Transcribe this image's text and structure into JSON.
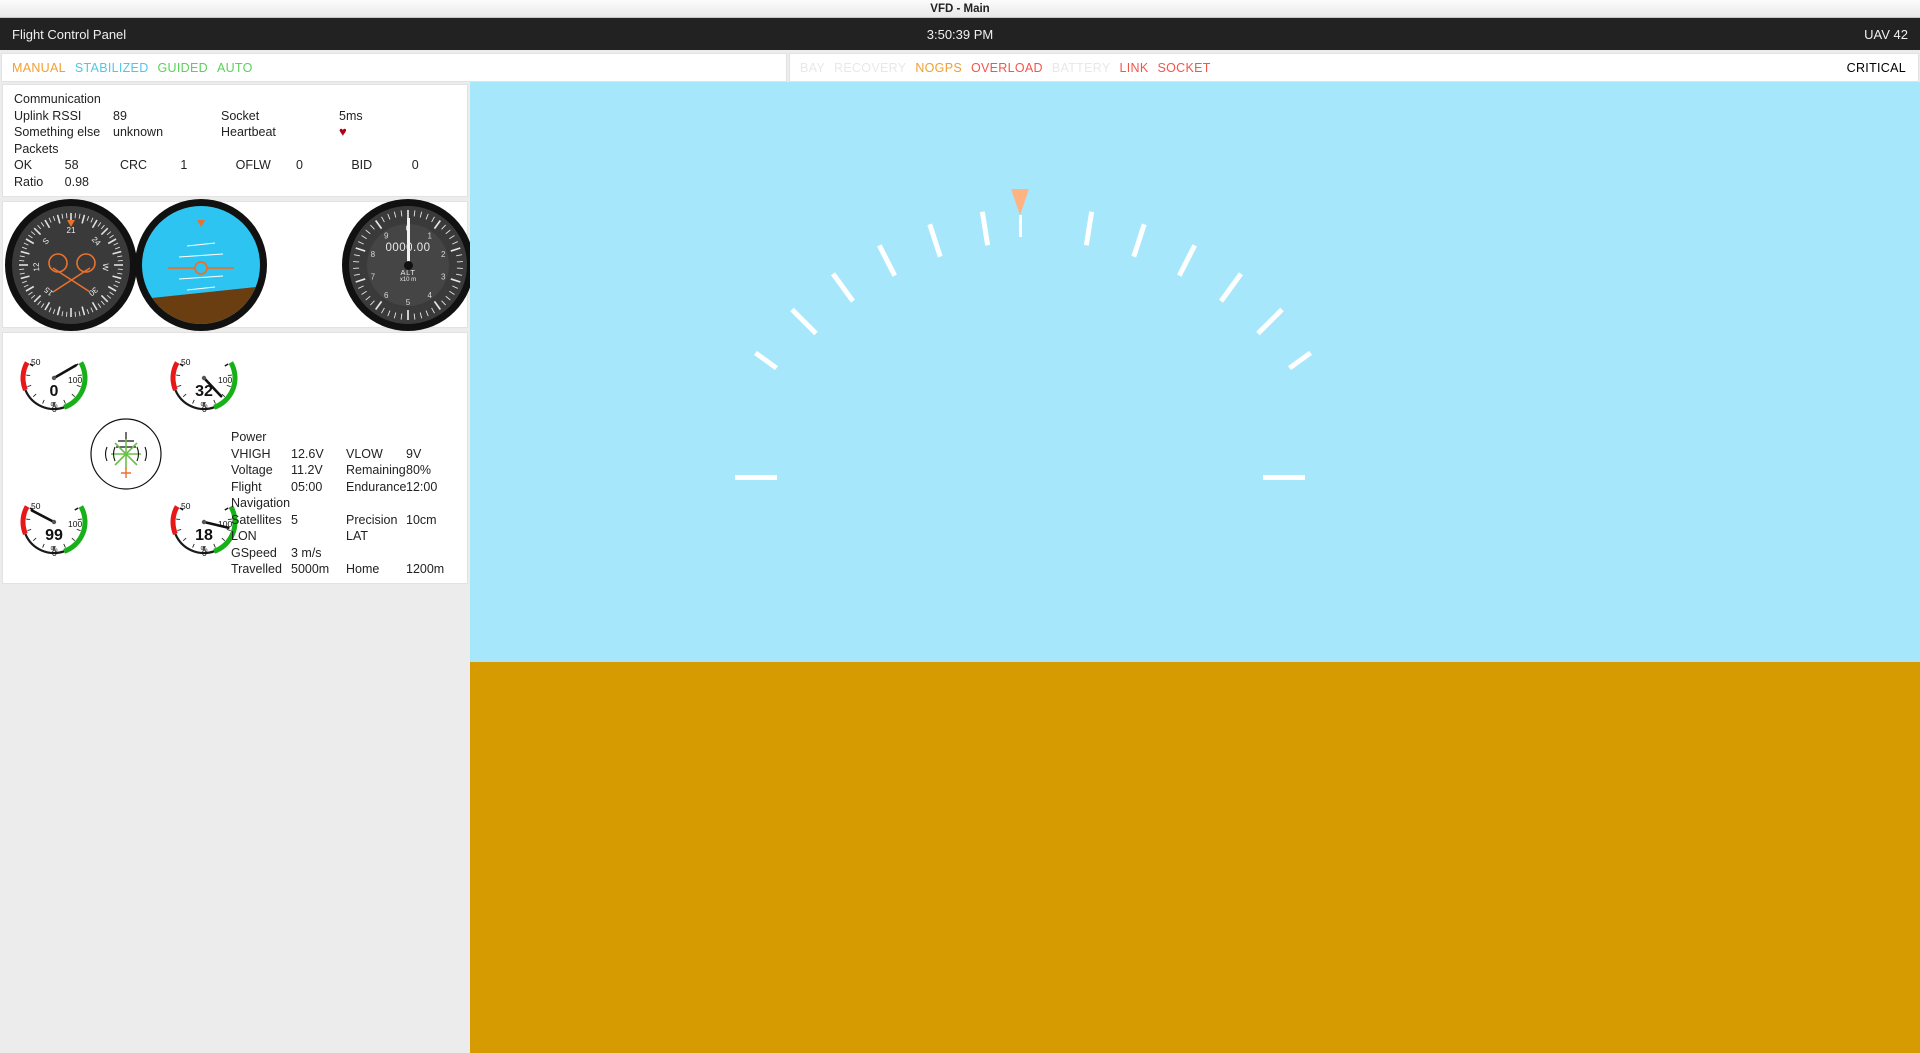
{
  "window": {
    "title": "VFD - Main"
  },
  "appbar": {
    "title": "Flight Control Panel",
    "clock": "3:50:39 PM",
    "uav": "UAV 42"
  },
  "modes": [
    {
      "label": "MANUAL",
      "color": "#f0a030",
      "active": true
    },
    {
      "label": "STABILIZED",
      "color": "#4ec8e8",
      "active": true
    },
    {
      "label": "GUIDED",
      "color": "#5bd05b",
      "active": true
    },
    {
      "label": "AUTO",
      "color": "#5bd05b",
      "active": true
    }
  ],
  "warnings": [
    {
      "label": "BAY",
      "color": "#e8e8e8"
    },
    {
      "label": "RECOVERY",
      "color": "#e8e8e8"
    },
    {
      "label": "NOGPS",
      "color": "#f0a030"
    },
    {
      "label": "OVERLOAD",
      "color": "#f4554a"
    },
    {
      "label": "BATTERY",
      "color": "#e8e8e8"
    },
    {
      "label": "LINK",
      "color": "#f4554a"
    },
    {
      "label": "SOCKET",
      "color": "#f4554a"
    }
  ],
  "critical": {
    "label": "CRITICAL",
    "color": "#f4554a"
  },
  "communication": {
    "section": "Communication",
    "rows": [
      {
        "k1": "Uplink RSSI",
        "v1": "89",
        "k2": "Socket",
        "v2": "5ms"
      },
      {
        "k1": "Something else",
        "v1": "unknown",
        "k2": "Heartbeat",
        "v2": "heart-icon"
      }
    ],
    "heartbeat_glyph": "♥",
    "packets_section": "Packets",
    "packets": [
      {
        "k1": "OK",
        "v1": "58",
        "k2": "CRC",
        "v2": "1",
        "k3": "OFLW",
        "v3": "0",
        "k4": "BID",
        "v4": "0"
      },
      {
        "k1": "Ratio",
        "v1": "0.98",
        "k2": "",
        "v2": "",
        "k3": "",
        "v3": "",
        "k4": "",
        "v4": ""
      }
    ]
  },
  "instruments": {
    "compass": {
      "name": "compass-rose",
      "heading_ticks": [
        "15",
        "12",
        "S",
        "21",
        "24",
        "W",
        "30"
      ]
    },
    "horizon": {
      "name": "artificial-horizon"
    },
    "altimeter": {
      "digits": "0000.00",
      "label": "ALT",
      "unit": "x10 m",
      "ticks": [
        "0",
        "1",
        "2",
        "3",
        "4",
        "5",
        "6",
        "7",
        "8",
        "9"
      ]
    }
  },
  "percent_gauges": [
    {
      "name": "gauge-throttle-left",
      "value": "0",
      "unit": "%",
      "t0": "0",
      "t50": "50",
      "t100": "100",
      "pct": 0
    },
    {
      "name": "gauge-throttle-right",
      "value": "32",
      "unit": "%",
      "t0": "0",
      "t50": "50",
      "t100": "100",
      "pct": 32
    },
    {
      "name": "gauge-power-left",
      "value": "99",
      "unit": "%",
      "t0": "0",
      "t50": "50",
      "t100": "100",
      "pct": 99
    },
    {
      "name": "gauge-power-right",
      "value": "18",
      "unit": "%",
      "t0": "0",
      "t50": "50",
      "t100": "100",
      "pct": 18
    }
  ],
  "power": {
    "section": "Power",
    "rows": [
      {
        "k1": "VHIGH",
        "v1": "12.6V",
        "k2": "VLOW",
        "v2": "9V"
      },
      {
        "k1": "Voltage",
        "v1": "11.2V",
        "k2": "Remaining",
        "v2": "80%"
      },
      {
        "k1": "Flight",
        "v1": "05:00",
        "k2": "Endurance",
        "v2": "12:00"
      }
    ]
  },
  "navigation": {
    "section": "Navigation",
    "rows": [
      {
        "k1": "Satellites",
        "v1": "5",
        "k2": "Precision",
        "v2": "10cm"
      },
      {
        "k1": "LON",
        "v1": "",
        "k2": "LAT",
        "v2": ""
      },
      {
        "k1": "GSpeed",
        "v1": "3 m/s",
        "k2": "",
        "v2": ""
      },
      {
        "k1": "Travelled",
        "v1": "5000m",
        "k2": "Home",
        "v2": "1200m"
      }
    ]
  },
  "hud": {
    "name": "primary-flight-display",
    "sky_color": "#a6e7fb",
    "ground_color": "#d69b00",
    "heading_marker_color": "#ffb380"
  }
}
